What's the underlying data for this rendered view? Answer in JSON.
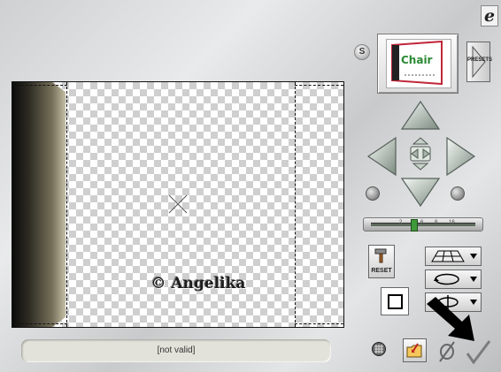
{
  "status": {
    "text": "[not valid]"
  },
  "canvas": {
    "watermark": "© Angelika"
  },
  "preview": {
    "thumb_text": "Chair"
  },
  "buttons": {
    "presets_label": "PRESETS",
    "reset_label": "RESET",
    "s_label": "S"
  },
  "zoom": {
    "ticks": [
      "2",
      "6",
      "8",
      "16"
    ],
    "knob_value_fraction": 0.38
  },
  "app": {
    "logo_glyph": "e"
  },
  "colors": {
    "accent_green": "#3f9a3a",
    "panel_dark": "#1a1a16",
    "status_bg": "#e3e2da"
  },
  "icons": {
    "navigation": [
      "nav-up-icon",
      "nav-left-icon",
      "nav-right-icon",
      "nav-down-icon",
      "inner-up-icon",
      "inner-left-icon",
      "inner-right-icon",
      "inner-down-icon"
    ],
    "rotate": [
      "rotate-left-icon",
      "rotate-right-icon"
    ],
    "tools": [
      "reset-hammer-icon",
      "perspective-grid-icon",
      "rotate-circle-icon",
      "flip-icon",
      "rectangle-frame-icon"
    ],
    "bottom": [
      "grid-icon",
      "folder-icon",
      "cancel-icon",
      "ok-check-icon",
      "black-arrow-icon"
    ]
  }
}
